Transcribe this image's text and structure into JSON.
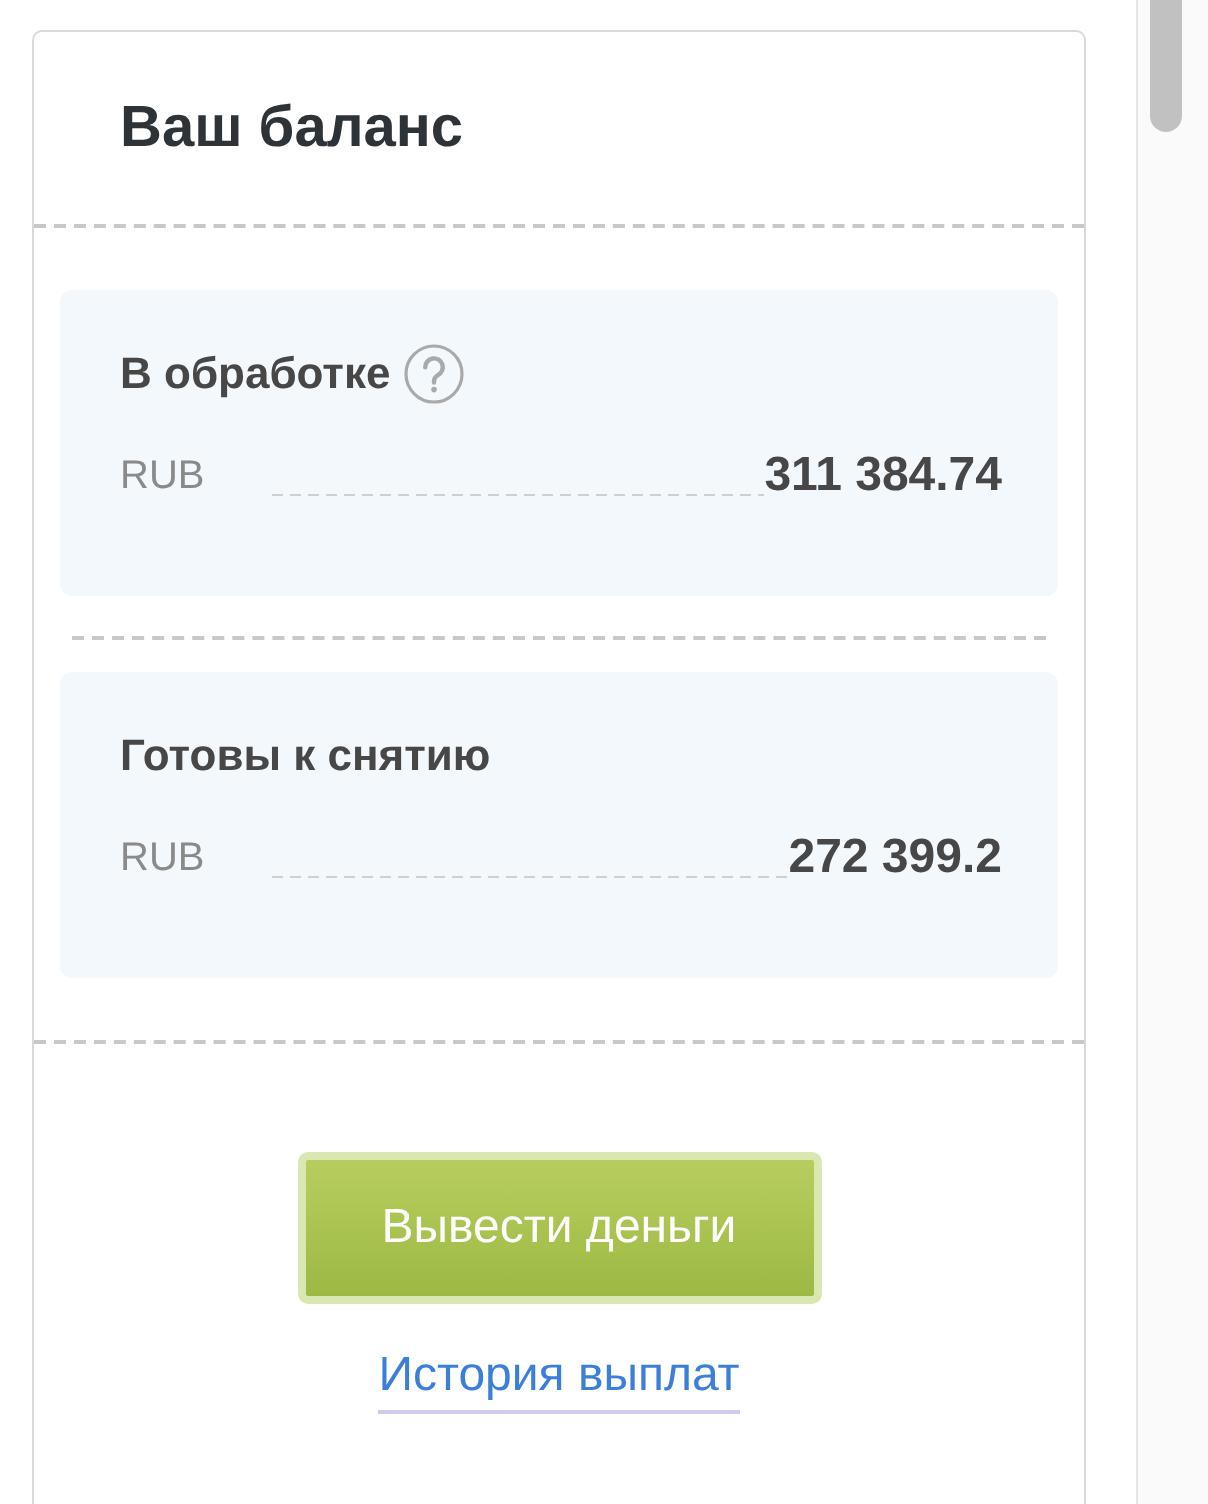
{
  "header": {
    "title": "Ваш баланс"
  },
  "balances": [
    {
      "label": "В обработке",
      "help_icon": true,
      "currency": "RUB",
      "amount": "311 384.74"
    },
    {
      "label": "Готовы к снятию",
      "help_icon": false,
      "currency": "RUB",
      "amount": "272 399.2"
    }
  ],
  "actions": {
    "withdraw_button": "Вывести деньги",
    "history_link": "История выплат"
  }
}
